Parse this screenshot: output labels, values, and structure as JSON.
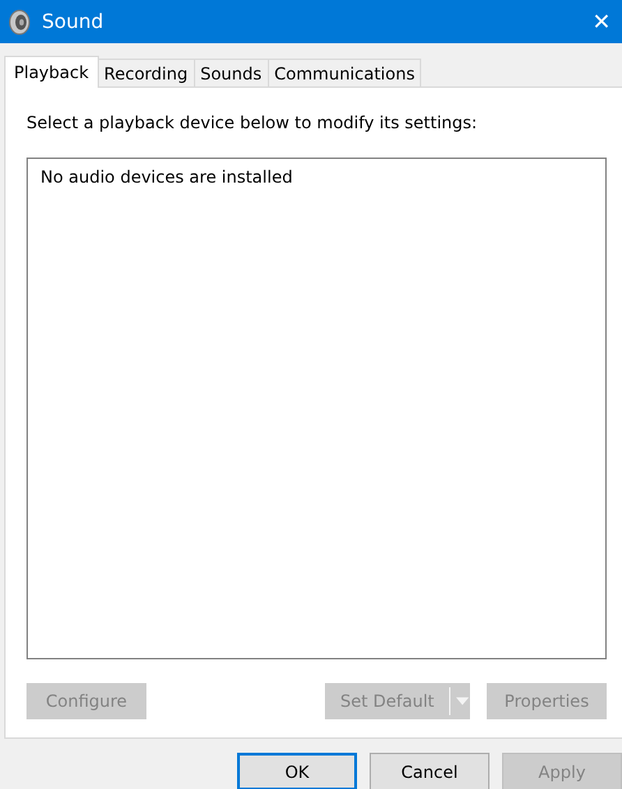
{
  "window": {
    "title": "Sound",
    "close": "✕"
  },
  "tabs": [
    {
      "label": "Playback",
      "selected": true
    },
    {
      "label": "Recording",
      "selected": false
    },
    {
      "label": "Sounds",
      "selected": false
    },
    {
      "label": "Communications",
      "selected": false
    }
  ],
  "instruction": "Select a playback device below to modify its settings:",
  "device_list": {
    "empty_message": "No audio devices are installed"
  },
  "panel_buttons": [
    {
      "kind": "plain",
      "label": "Configure",
      "disabled": true
    },
    {
      "kind": "split",
      "label": "Set Default",
      "disabled": true
    },
    {
      "kind": "plain",
      "label": "Properties",
      "disabled": true
    }
  ],
  "dialog_buttons": [
    {
      "label": "OK",
      "default": true,
      "disabled": false
    },
    {
      "label": "Cancel",
      "default": false,
      "disabled": false
    },
    {
      "label": "Apply",
      "default": false,
      "disabled": true
    }
  ]
}
